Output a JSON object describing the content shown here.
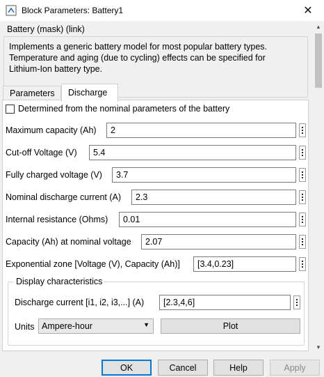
{
  "window": {
    "title": "Block Parameters: Battery1",
    "close_glyph": "✕"
  },
  "mask": {
    "title": "Battery (mask) (link)",
    "description": "Implements a generic battery model for most popular battery types.\nTemperature and aging (due to cycling) effects can be specified for\nLithium-Ion battery type."
  },
  "tabs": [
    {
      "label": "Parameters",
      "active": false
    },
    {
      "label": "Discharge",
      "active": true
    }
  ],
  "discharge": {
    "checkbox_label": "Determined from the nominal parameters of the battery",
    "checkbox_checked": false,
    "fields": [
      {
        "label": "Maximum capacity (Ah)",
        "value": "2"
      },
      {
        "label": "Cut-off Voltage (V)",
        "value": "5.4"
      },
      {
        "label": "Fully charged voltage (V)",
        "value": "3.7"
      },
      {
        "label": "Nominal discharge current (A)",
        "value": "2.3"
      },
      {
        "label": "Internal resistance (Ohms)",
        "value": "0.01"
      },
      {
        "label": "Capacity (Ah) at nominal voltage",
        "value": "2.07"
      },
      {
        "label": "Exponential zone [Voltage (V), Capacity (Ah)]",
        "value": "[3.4,0.23]"
      }
    ],
    "display": {
      "title": "Display characteristics",
      "current_label": "Discharge current [i1, i2, i3,...] (A)",
      "current_value": "[2.3,4,6]",
      "units_label": "Units",
      "units_value": "Ampere-hour",
      "plot_label": "Plot"
    }
  },
  "footer": {
    "ok": "OK",
    "cancel": "Cancel",
    "help": "Help",
    "apply": "Apply"
  },
  "colors": {
    "accent": "#0078d7",
    "panel": "#ffffff",
    "background": "#f0f0f0"
  }
}
